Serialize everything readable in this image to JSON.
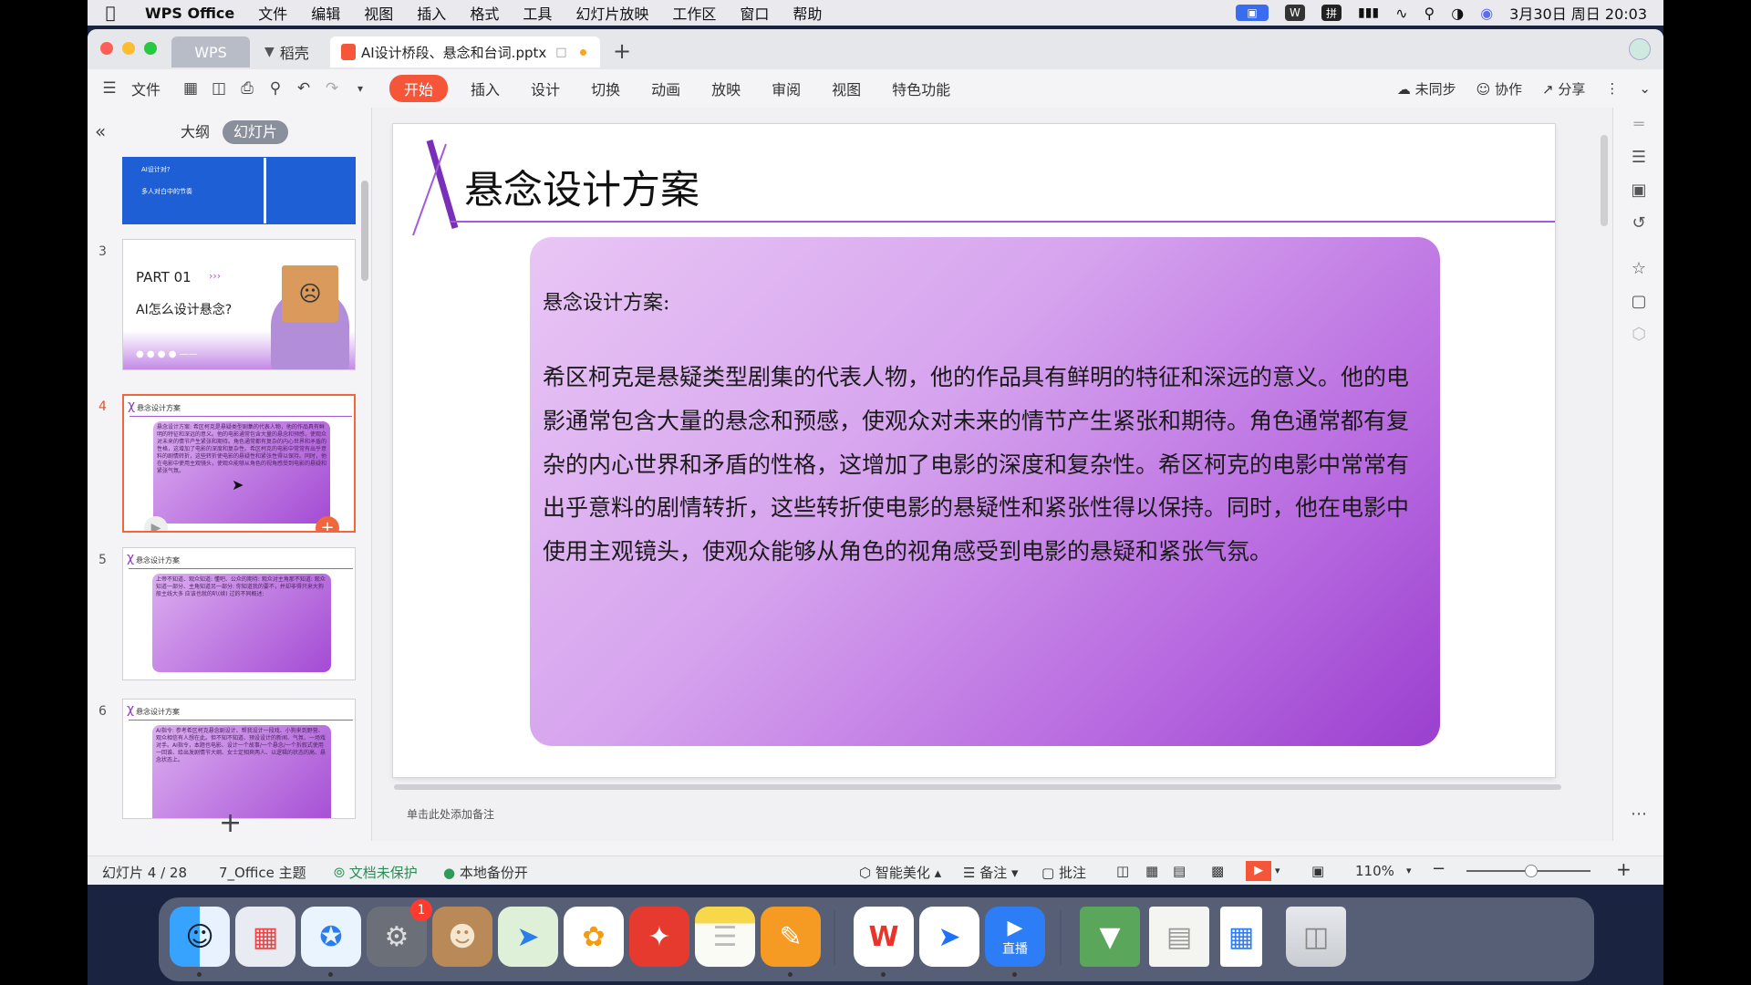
{
  "menubar": {
    "app_name": "WPS Office",
    "items": [
      "文件",
      "编辑",
      "视图",
      "插入",
      "格式",
      "工具",
      "幻灯片放映",
      "工作区",
      "窗口",
      "帮助"
    ],
    "datetime": "3月30日 周日  20:03",
    "input_method": "拼"
  },
  "tabs": {
    "wps_label": "WPS",
    "daoke_label": "稻壳",
    "document_label": "AI设计桥段、悬念和台词.pptx"
  },
  "toolbar": {
    "file_label": "文件",
    "ribbon_tabs": [
      "开始",
      "插入",
      "设计",
      "切换",
      "动画",
      "放映",
      "审阅",
      "视图",
      "特色功能"
    ],
    "unsynced_label": "未同步",
    "collaborate_label": "协作",
    "share_label": "分享"
  },
  "leftpanel": {
    "outline_label": "大纲",
    "slides_label": "幻灯片",
    "thumbs": [
      {
        "num": "",
        "items": [
          "AI设计对?",
          "多人对白中的节奏"
        ]
      },
      {
        "num": "3",
        "part": "PART 01",
        "subtitle": "AI怎么设计悬念?"
      },
      {
        "num": "4",
        "title": "悬念设计方案",
        "text": "悬念设计方案: 希区柯克是悬疑类型剧集的代表人物，他的作品具有鲜明的特征和深远的意义。他的电影通常包含大量的悬念和预感，使观众对未来的情节产生紧张和期待。角色通常都有复杂的内心世界和矛盾的性格，这增加了电影的深度和复杂性。希区柯克的电影中常常有出乎意料的剧情转折，这些转折使电影的悬疑性和紧张性得以保持。同时，他在电影中使用主观镜头，使观众能够从角色的视角感受到电影的悬疑和紧张气氛。"
      },
      {
        "num": "5",
        "title": "悬念设计方案",
        "text": "上帝不知道、观众知道: 懂吧、公众的期待: 观众对主角那不知道: 观众知道一部分、主角知道另一部分: 你知道我的要不，并却非得只来大狗般主线大多  应该也就的叭(续) 过的不同概述:"
      },
      {
        "num": "6",
        "title": "悬念设计方案",
        "text": "AI指令: 参考希区柯克悬念剧设计、帮我设计一段戏、小狗来到野营、观众相信有人想在此。但不知不知道、预设设计的新闻、气氛、一场戏对手。AI指令，本题也电影、设计一个故事/一个悬念/一个拆叙式使用一回谁、给出发剧情节大纲、女士定相爽两人、以逻辑的状态的高、悬念状态上。"
      }
    ]
  },
  "slide": {
    "title": "悬念设计方案",
    "heading": "悬念设计方案:",
    "paragraph": "希区柯克是悬疑类型剧集的代表人物，他的作品具有鲜明的特征和深远的意义。他的电影通常包含大量的悬念和预感，使观众对未来的情节产生紧张和期待。角色通常都有复杂的内心世界和矛盾的性格，这增加了电影的深度和复杂性。希区柯克的电影中常常有出乎意料的剧情转折，这些转折使电影的悬疑性和紧张性得以保持。同时，他在电影中使用主观镜头，使观众能够从角色的视角感受到电影的悬疑和紧张气氛。",
    "notes_placeholder": "单击此处添加备注"
  },
  "statusbar": {
    "slide_position": "幻灯片 4 / 28",
    "theme": "7_Office 主题",
    "protect": "文档未保护",
    "backup": "本地备份开",
    "beautify": "智能美化",
    "notes": "备注",
    "comments": "批注",
    "zoom": "110%"
  },
  "dock": {
    "settings_badge": "1",
    "live_label": "直播"
  },
  "colors": {
    "accent": "#f5563a",
    "purple": "#a45ad8"
  }
}
